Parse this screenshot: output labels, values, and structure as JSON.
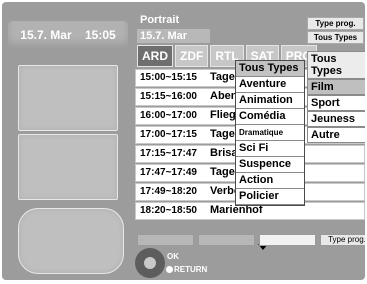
{
  "left_panel": {
    "date": "15.7. Mar",
    "time": "15:05"
  },
  "header": {
    "title": "Portrait",
    "subdate": "15.7. Mar"
  },
  "channels": [
    "ARD",
    "ZDF",
    "RTL",
    "SAT",
    "PRO"
  ],
  "program_rows": [
    {
      "time": "15:00~15:15",
      "title": "Tages"
    },
    {
      "time": "15:15~16:00",
      "title": "Aben"
    },
    {
      "time": "16:00~17:00",
      "title": "Fliege"
    },
    {
      "time": "17:00~17:15",
      "title": "Tages"
    },
    {
      "time": "17:15~17:47",
      "title": "Brisa"
    },
    {
      "time": "17:47~17:49",
      "title": "Tage"
    },
    {
      "time": "17:49~18:20",
      "title": "Verbo"
    },
    {
      "time": "18:20~18:50",
      "title": "Marienhof"
    }
  ],
  "type_prog_badge": {
    "label": "Type prog.",
    "sub": "Tous Types"
  },
  "category_list": {
    "header": "Tous Types",
    "items": [
      "Film",
      "Sport",
      "Jeuness",
      "Autre"
    ]
  },
  "popup": {
    "items": [
      "Tous Types",
      "Aventure",
      "Animation",
      "Comédia",
      "Dramatique",
      "Sci Fi",
      "Suspence",
      "Action",
      "Policier"
    ]
  },
  "footer": {
    "type_prog_button": "Type prog.",
    "ok_label": "OK",
    "return_label": "RETURN"
  }
}
